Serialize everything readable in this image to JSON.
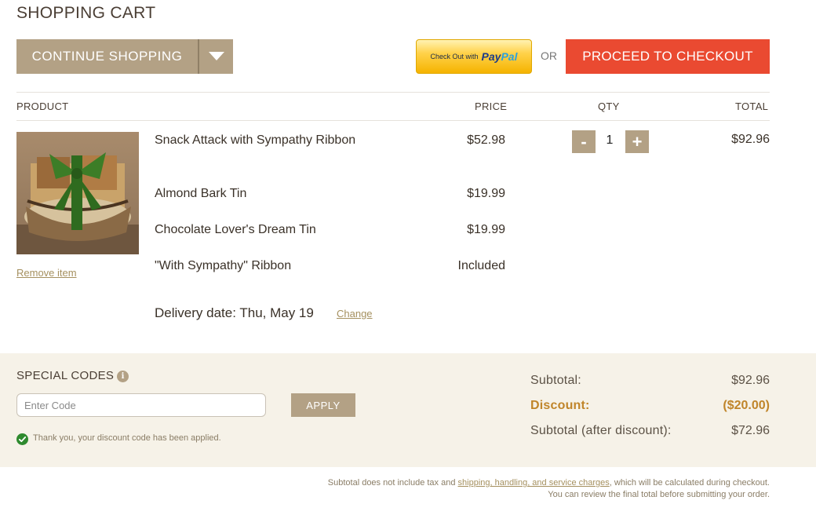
{
  "header": {
    "title": "SHOPPING CART",
    "continue_label": "CONTINUE SHOPPING",
    "paypal_small": "Check Out with",
    "paypal_brand_1": "Pay",
    "paypal_brand_2": "Pal",
    "or_label": "OR",
    "checkout_label": "PROCEED TO CHECKOUT"
  },
  "table": {
    "headers": {
      "product": "PRODUCT",
      "price": "PRICE",
      "qty": "QTY",
      "total": "TOTAL"
    }
  },
  "cart_item": {
    "image_name": "gift-basket-image",
    "remove_label": "Remove item",
    "lines": [
      {
        "name": "Snack Attack with Sympathy Ribbon",
        "price": "$52.98"
      },
      {
        "name": "Almond Bark Tin",
        "price": "$19.99"
      },
      {
        "name": "Chocolate Lover's Dream Tin",
        "price": "$19.99"
      },
      {
        "name": "\"With Sympathy\" Ribbon",
        "price": "Included"
      }
    ],
    "qty_minus": "-",
    "quantity": "1",
    "qty_plus": "+",
    "total": "$92.96",
    "delivery_text": "Delivery date: Thu, May 19",
    "delivery_change": "Change"
  },
  "codes": {
    "title": "SPECIAL CODES",
    "info_icon": "i",
    "input_placeholder": "Enter Code",
    "input_value": "",
    "apply_label": "APPLY",
    "success_message": "Thank you, your discount code has been applied."
  },
  "summary": {
    "subtotal_label": "Subtotal:",
    "subtotal_value": "$92.96",
    "discount_label": "Discount:",
    "discount_value": "($20.00)",
    "after_label": "Subtotal (after discount):",
    "after_value": "$72.96"
  },
  "footer": {
    "line1_pre": "Subtotal does not include tax and ",
    "line1_link": "shipping, handling, and service charges",
    "line1_post": ", which will be calculated during checkout.",
    "line2": "You can review the final total before submitting your order."
  },
  "colors": {
    "accent_tan": "#b3a185",
    "checkout_red": "#ea4a31",
    "discount_gold": "#c0852a",
    "panel_bg": "#f6f2e8"
  },
  "icons": [
    "chevron-down-icon",
    "info-icon",
    "check-circle-icon",
    "minus-icon",
    "plus-icon"
  ]
}
